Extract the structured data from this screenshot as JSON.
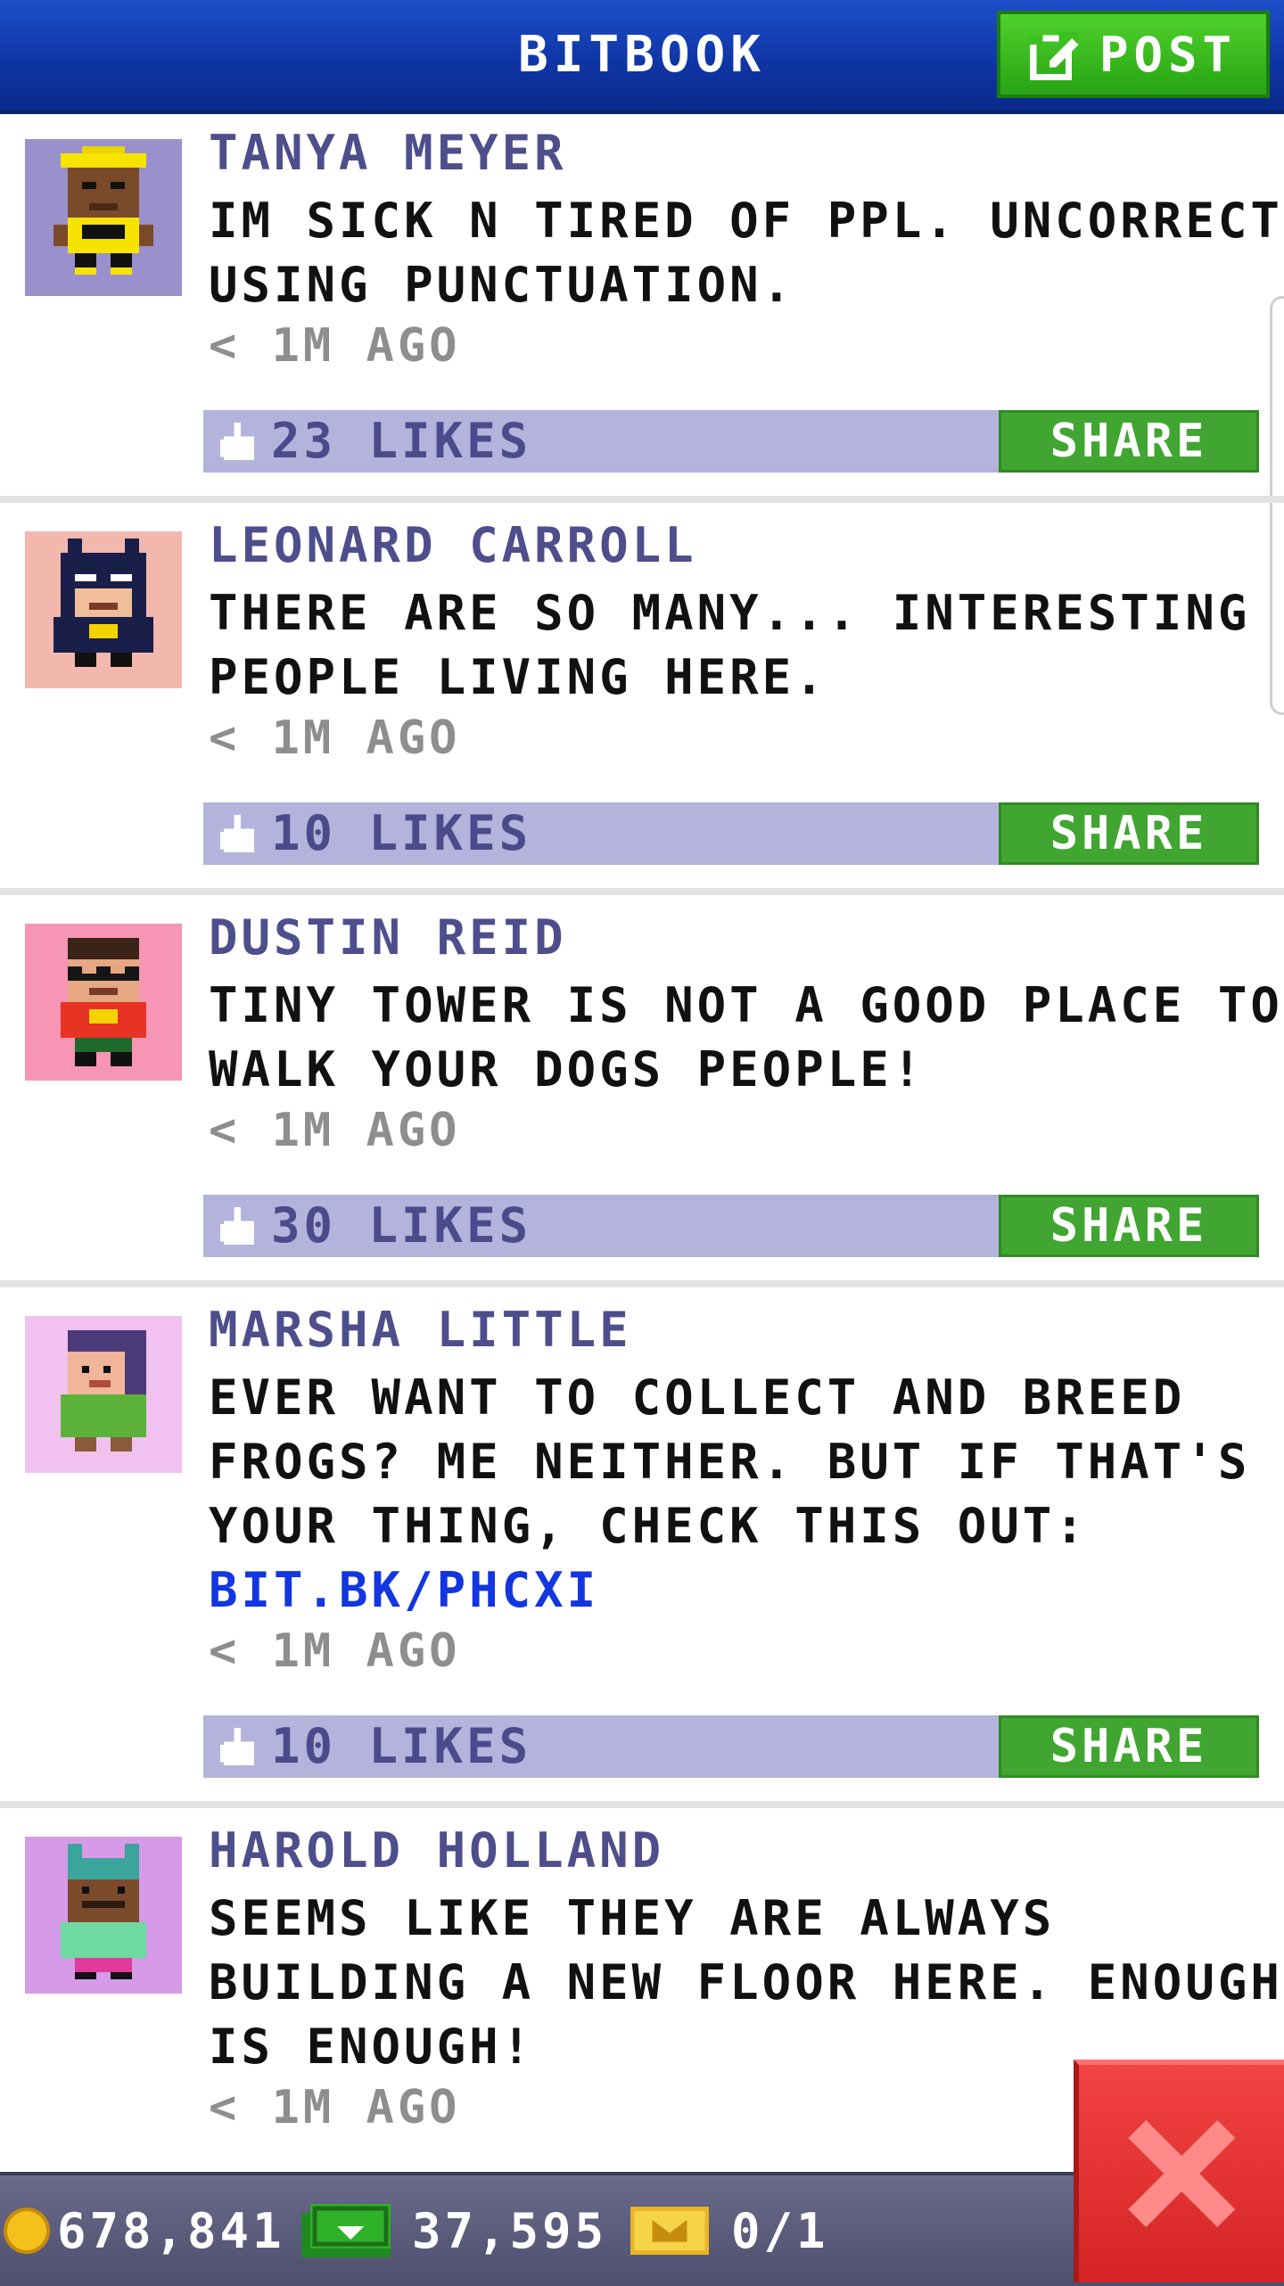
{
  "header": {
    "title": "BITBOOK",
    "post_label": "POST"
  },
  "posts": [
    {
      "author": "TANYA MEYER",
      "lines": [
        "IM SICK N TIRED OF PPL. UNCORRECTLY",
        "USING PUNCTUATION."
      ],
      "time": "< 1M AGO",
      "likes": "23 LIKES",
      "share_label": "SHARE",
      "avatar_bg": "#9a90cc"
    },
    {
      "author": "LEONARD CARROLL",
      "lines": [
        "THERE ARE SO MANY... INTERESTING",
        "PEOPLE LIVING HERE."
      ],
      "time": "< 1M AGO",
      "likes": "10 LIKES",
      "share_label": "SHARE",
      "avatar_bg": "#f2b8ae"
    },
    {
      "author": "DUSTIN REID",
      "lines": [
        "TINY TOWER IS NOT A GOOD PLACE TO",
        "WALK YOUR DOGS PEOPLE!"
      ],
      "time": "< 1M AGO",
      "likes": "30 LIKES",
      "share_label": "SHARE",
      "avatar_bg": "#f795b5"
    },
    {
      "author": "MARSHA LITTLE",
      "lines": [
        "EVER WANT TO COLLECT AND BREED",
        "FROGS? ME NEITHER. BUT IF THAT'S",
        "YOUR THING, CHECK THIS OUT:"
      ],
      "link": "BIT.BK/PHCXI",
      "time": "< 1M AGO",
      "likes": "10 LIKES",
      "share_label": "SHARE",
      "avatar_bg": "#f1c2f0"
    },
    {
      "author": "HAROLD HOLLAND",
      "lines": [
        "SEEMS LIKE THEY ARE ALWAYS",
        "BUILDING A NEW FLOOR HERE. ENOUGH",
        "IS ENOUGH!"
      ],
      "time": "< 1M AGO",
      "avatar_bg": "#d59ae8"
    }
  ],
  "status": {
    "coins": "678,841",
    "bux": "37,595",
    "tickets": "0/1"
  },
  "colors": {
    "accent": "#1d4fc9",
    "share_green": "#41a631",
    "likes_bar": "#b3b3dc",
    "link": "#1236e0"
  },
  "icons": [
    "edit-icon",
    "like-icon",
    "coin-icon",
    "bux-icon",
    "ticket-icon",
    "close-icon"
  ]
}
